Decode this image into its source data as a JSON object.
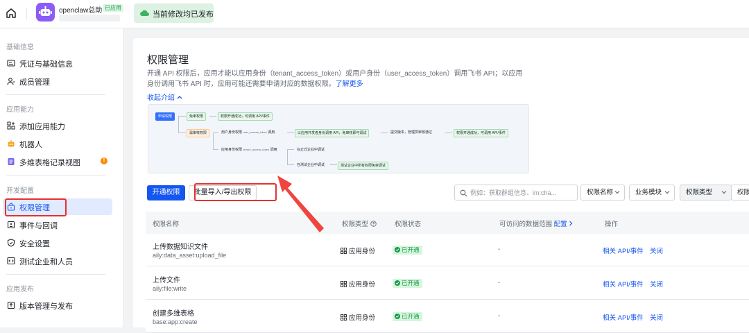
{
  "topbar": {
    "app_name": "openclaw总助",
    "app_label": "已应用",
    "publish_status": "当前修改均已发布"
  },
  "sidebar": {
    "sections": [
      {
        "title": "基础信息",
        "items": [
          "凭证与基础信息",
          "成员管理"
        ]
      },
      {
        "title": "应用能力",
        "items": [
          "添加应用能力",
          "机器人",
          "多维表格记录视图"
        ]
      },
      {
        "title": "开发配置",
        "items": [
          "权限管理",
          "事件与回调",
          "安全设置",
          "测试企业和人员"
        ]
      },
      {
        "title": "应用发布",
        "items": [
          "版本管理与发布"
        ]
      }
    ],
    "active_item": "权限管理",
    "badge": "!"
  },
  "page": {
    "title": "权限管理",
    "description": "开通 API 权限后，应用才能以应用身份（tenant_access_token）或用户身份（user_access_token）调用飞书 API；以应用身份调用飞书 API 时，应用可能还需要申请对应的数据权限。",
    "learn_more": "了解更多",
    "collapse": "收起介绍"
  },
  "flow": {
    "apply": "申请权限",
    "no_review": "免审权限",
    "no_review_result": "权限开通成功，可调用 API/事件",
    "need_review": "需审核权限",
    "user_perm": "用户身份权限",
    "user_token": "user_access_token",
    "app_perm": "应用身份权限",
    "app_token": "tenant_access_token",
    "apply_suffix": "调用",
    "dev_call": "以应用开发者身份调用 API，免审核即可调试",
    "submit": "提交版本，管理员审核通过",
    "success": "权限开通成功，可调用 API/事件",
    "prod_debug": "在正式企业中调试",
    "test_debug": "在测试企业中调试",
    "test_result": "测试企业中所有权限免审调试"
  },
  "toolbar": {
    "open_button": "开通权限",
    "bulk_button": "批量导入/导出权限",
    "search_placeholder": "例如：获取群组信息、im:cha...",
    "filters": [
      "权限名称",
      "业务模块",
      "权限类型",
      "权限"
    ]
  },
  "table": {
    "headers": [
      "权限名称",
      "权限类型",
      "权限状态",
      "可访问的数据范围",
      "配置",
      "操作"
    ],
    "rows": [
      {
        "name": "上传数据知识文件",
        "code": "aily:data_asset:upload_file",
        "type": "应用身份",
        "status": "已开通",
        "range": "-",
        "action1": "相关 API/事件",
        "action2": "关闭"
      },
      {
        "name": "上传文件",
        "code": "aily:file:write",
        "type": "应用身份",
        "status": "已开通",
        "range": "-",
        "action1": "相关 API/事件",
        "action2": "关闭"
      },
      {
        "name": "创建多维表格",
        "code": "base:app:create",
        "type": "应用身份",
        "status": "已开通",
        "range": "-",
        "action1": "相关 API/事件",
        "action2": "关闭"
      }
    ]
  },
  "colors": {
    "accent": "#1456f0",
    "success": "#1d9a4d",
    "annotation": "#e5302f"
  }
}
